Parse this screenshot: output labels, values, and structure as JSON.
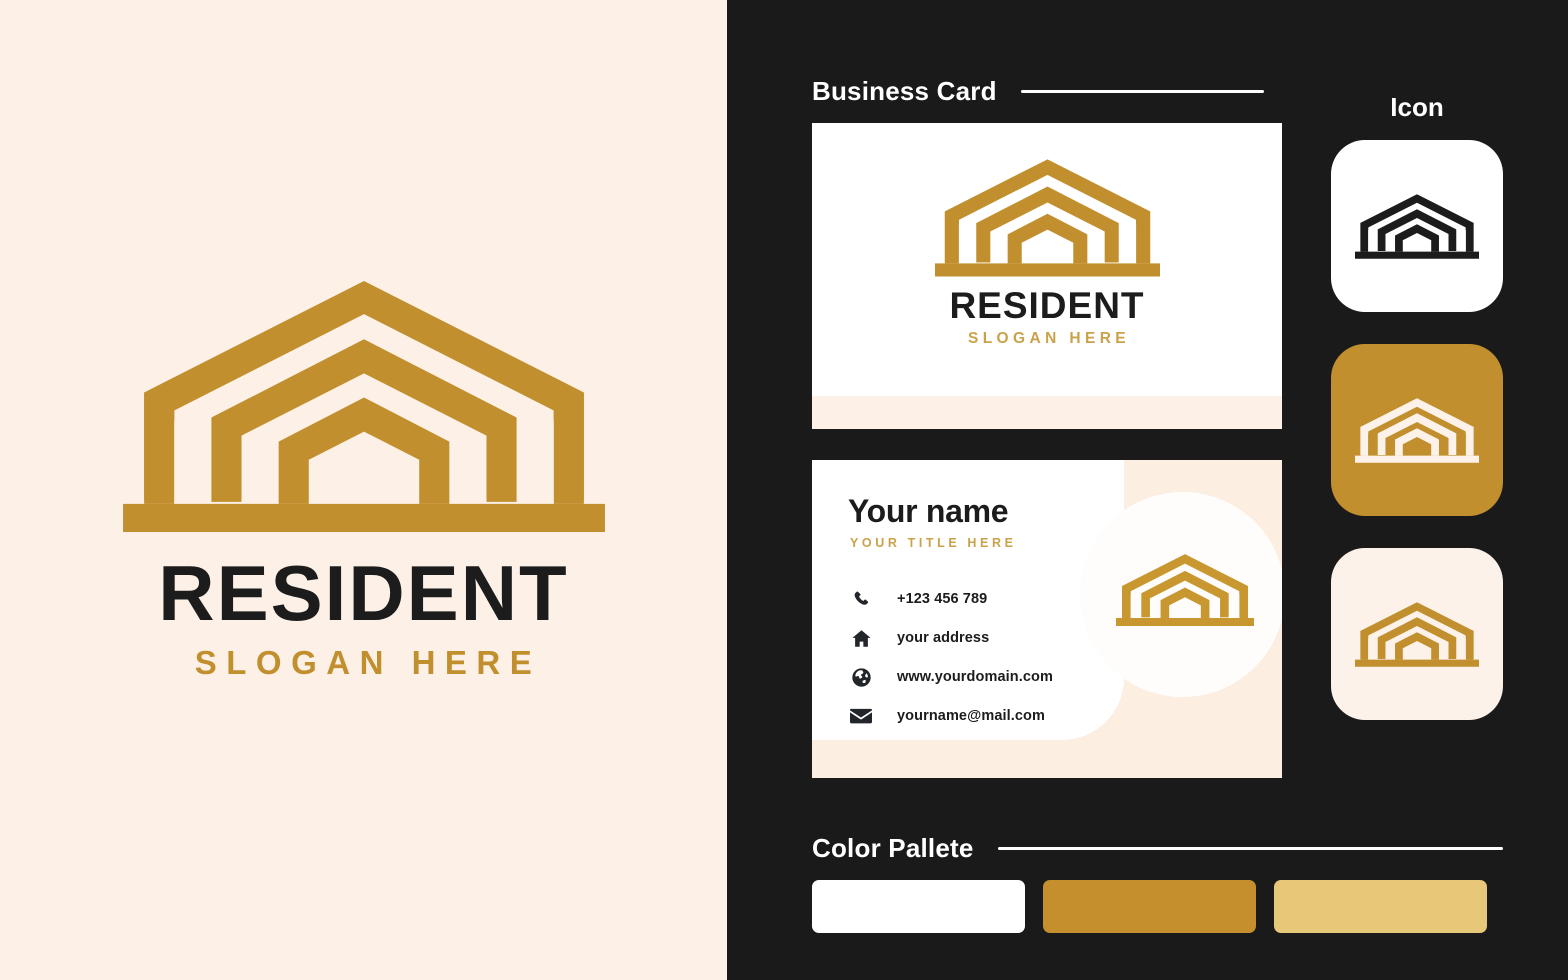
{
  "brand": {
    "name": "RESIDENT",
    "slogan": "SLOGAN HERE",
    "gold": "#C28F2E",
    "gold_light": "#E6C878",
    "dark": "#1C1C1C",
    "cream": "#FDF1E7",
    "panel_dark": "#1A1A1A",
    "white": "#FFFFFF"
  },
  "left_panel": {
    "logo_mark": "resident-building-logo",
    "wordmark": "RESIDENT",
    "slogan": "SLOGAN HERE"
  },
  "sections": {
    "business_card": {
      "title": "Business Card"
    },
    "icon": {
      "title": "Icon"
    },
    "color_palette": {
      "title": "Color Pallete"
    }
  },
  "business_card_front": {
    "logo_mark": "resident-building-logo",
    "wordmark": "RESIDENT",
    "slogan": "SLOGAN HERE"
  },
  "business_card_back": {
    "name": "Your name",
    "title": "YOUR TITLE HERE",
    "logo_mark": "resident-building-logo",
    "contacts": [
      {
        "icon": "phone-icon",
        "value": "+123 456 789"
      },
      {
        "icon": "home-icon",
        "value": "your address"
      },
      {
        "icon": "globe-icon",
        "value": "www.yourdomain.com"
      },
      {
        "icon": "envelope-icon",
        "value": "yourname@mail.com"
      }
    ]
  },
  "icon_tiles": [
    {
      "name": "icon-tile-light",
      "background": "#FFFFFF",
      "mark_color": "#1C1C1C"
    },
    {
      "name": "icon-tile-gold",
      "background": "#C28F2E",
      "mark_color": "#FDF2EA"
    },
    {
      "name": "icon-tile-cream",
      "background": "#FDF2EA",
      "mark_color": "#C28F2E"
    }
  ],
  "color_palette": {
    "swatches": [
      {
        "name": "swatch-white",
        "hex": "#FFFFFF"
      },
      {
        "name": "swatch-gold",
        "hex": "#C68F2E"
      },
      {
        "name": "swatch-gold-light",
        "hex": "#E6C878"
      }
    ]
  }
}
